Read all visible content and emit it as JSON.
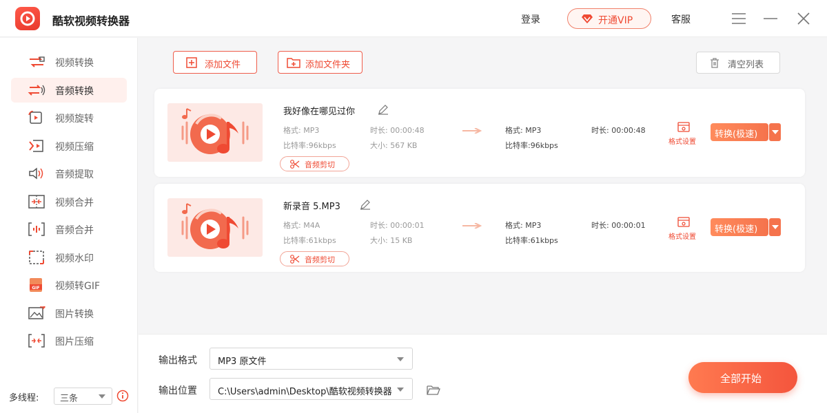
{
  "app": {
    "title": "酷软视频转换器"
  },
  "header": {
    "login": "登录",
    "vip": "开通VIP",
    "service": "客服"
  },
  "sidebar": {
    "items": [
      {
        "label": "视频转换",
        "icon": "video-convert-icon"
      },
      {
        "label": "音频转换",
        "icon": "audio-convert-icon",
        "active": true
      },
      {
        "label": "视频旋转",
        "icon": "video-rotate-icon"
      },
      {
        "label": "视频压缩",
        "icon": "video-compress-icon"
      },
      {
        "label": "音频提取",
        "icon": "audio-extract-icon"
      },
      {
        "label": "视频合并",
        "icon": "video-merge-icon"
      },
      {
        "label": "音频合并",
        "icon": "audio-merge-icon"
      },
      {
        "label": "视频水印",
        "icon": "video-watermark-icon"
      },
      {
        "label": "视频转GIF",
        "icon": "gif-icon"
      },
      {
        "label": "图片转换",
        "icon": "image-convert-icon"
      },
      {
        "label": "图片压缩",
        "icon": "image-compress-icon"
      }
    ],
    "thread_label": "多线程:",
    "thread_value": "三条"
  },
  "toolbar": {
    "add_file": "添加文件",
    "add_folder": "添加文件夹",
    "clear_list": "清空列表"
  },
  "files": [
    {
      "name": "我好像在哪见过你",
      "src_format": "格式: MP3",
      "src_duration": "时长: 00:00:48",
      "src_bitrate": "比特率:96kbps",
      "src_size": "大小: 567 KB",
      "dst_format": "格式: MP3",
      "dst_duration": "时长: 00:00:48",
      "dst_bitrate": "比特率:96kbps",
      "format_settings": "格式设置",
      "convert": "转换(极速)",
      "cut": "音频剪切"
    },
    {
      "name": "新录音 5.MP3",
      "src_format": "格式: M4A",
      "src_duration": "时长: 00:00:01",
      "src_bitrate": "比特率:61kbps",
      "src_size": "大小: 15 KB",
      "dst_format": "格式: MP3",
      "dst_duration": "时长: 00:00:01",
      "dst_bitrate": "比特率:61kbps",
      "format_settings": "格式设置",
      "convert": "转换(极速)",
      "cut": "音频剪切"
    }
  ],
  "output": {
    "format_label": "输出格式",
    "format_value": "MP3  原文件",
    "location_label": "输出位置",
    "location_value": "C:\\Users\\admin\\Desktop\\酷软视频转换器"
  },
  "start_all": "全部开始",
  "colors": {
    "accent": "#ef4a33",
    "accent_light": "#fff0ed",
    "button_gradient_start": "#ff7a50",
    "button_gradient_end": "#f4553d"
  }
}
